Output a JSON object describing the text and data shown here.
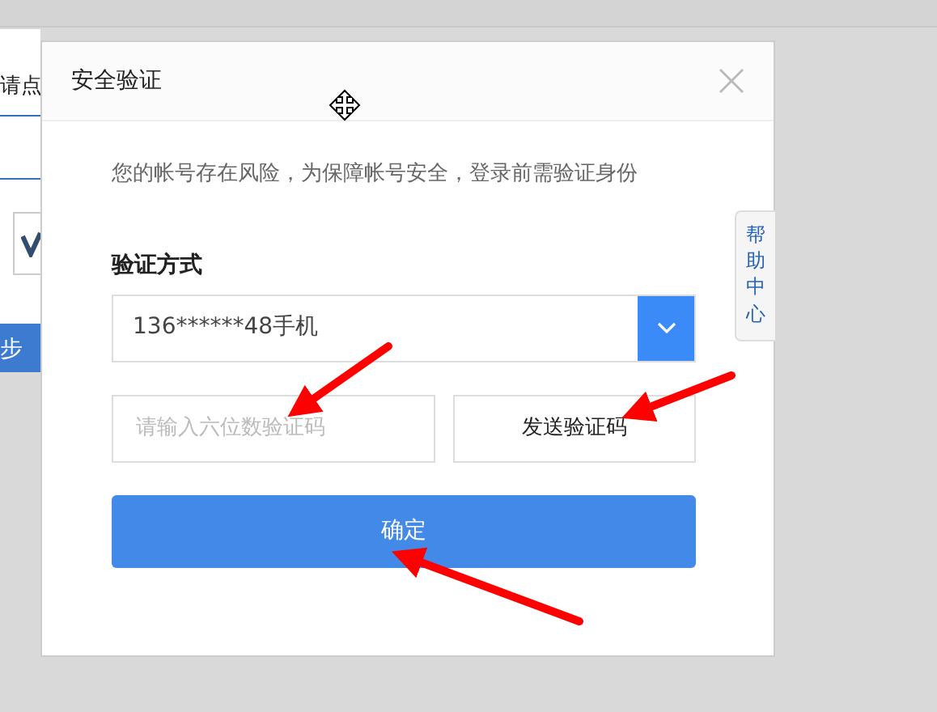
{
  "background_page": {
    "link_text": "请点",
    "button_label": "步"
  },
  "dialog": {
    "title": "安全验证",
    "notice": "您的帐号存在风险，为保障帐号安全，登录前需验证身份",
    "method_label": "验证方式",
    "method_select": {
      "value": "136******48手机"
    },
    "code_input": {
      "placeholder": "请输入六位数验证码"
    },
    "send_button": "发送验证码",
    "confirm_button": "确定"
  },
  "help_tab": {
    "label": "帮助中心"
  }
}
